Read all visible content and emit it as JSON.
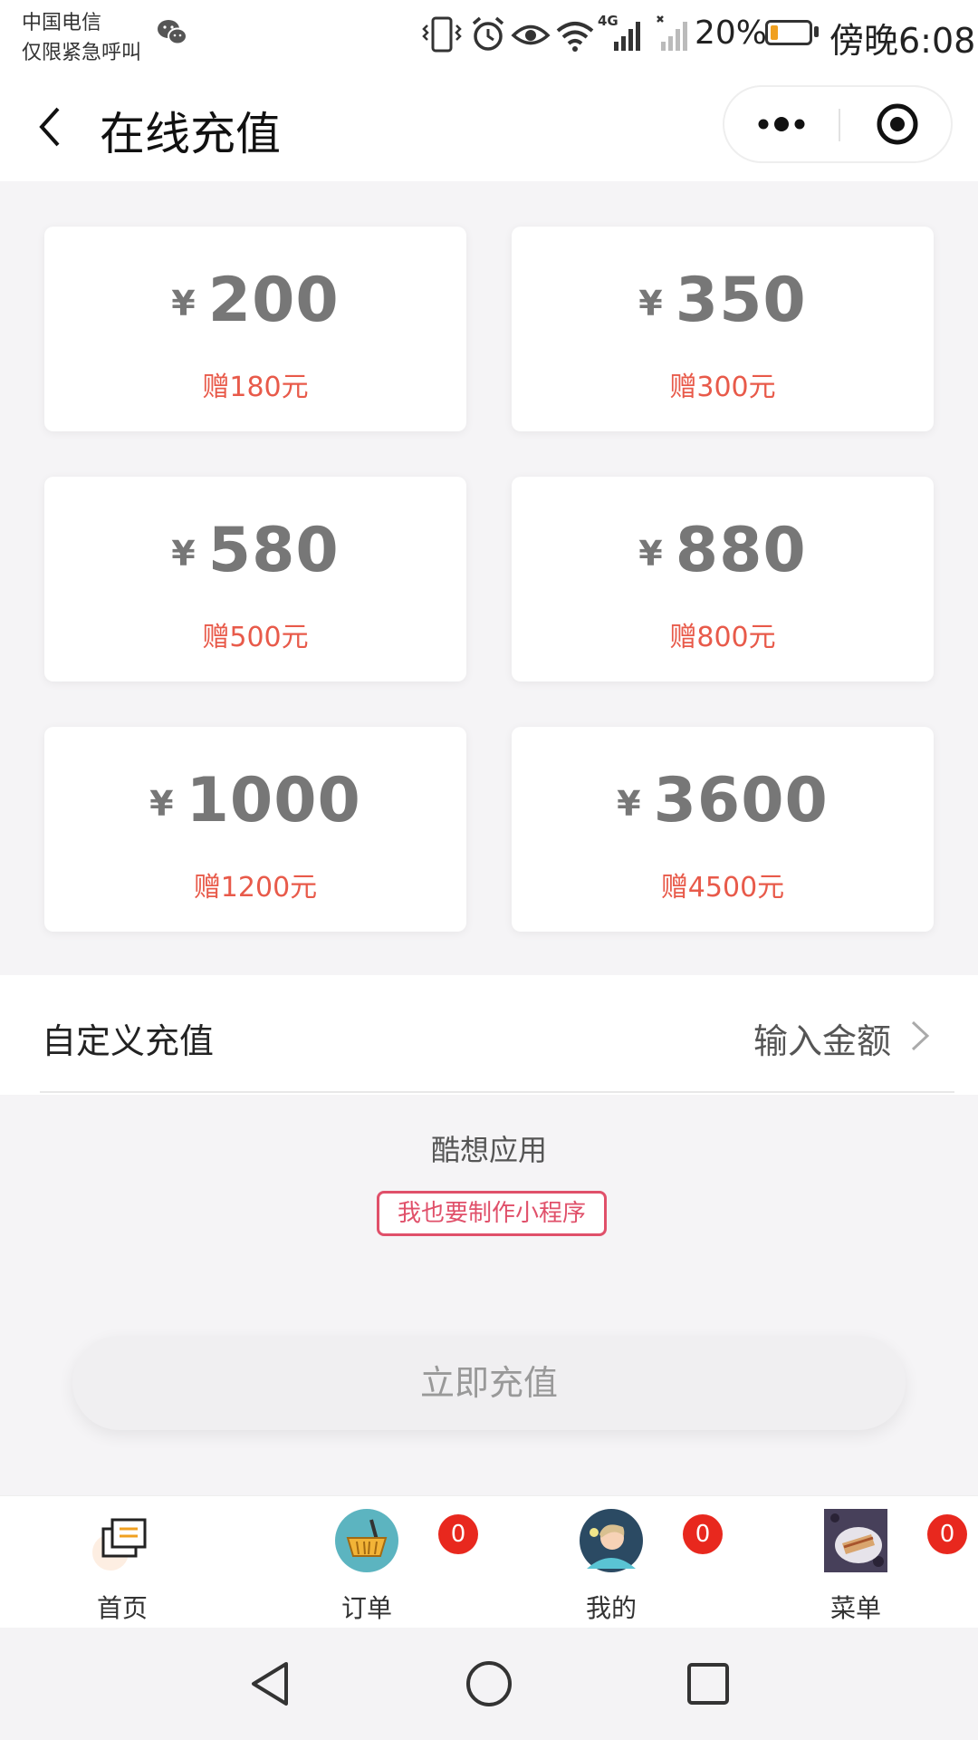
{
  "status_bar": {
    "carrier": "中国电信",
    "emergency": "仅限紧急呼叫",
    "network": "4G",
    "battery": "20%",
    "battery_level": 0.2,
    "time": "傍晚6:08",
    "icons": [
      "wechat-icon",
      "vibrate-icon",
      "alarm-icon",
      "eye-icon",
      "wifi-icon",
      "signal-icon",
      "no-signal-icon",
      "battery-icon"
    ]
  },
  "nav": {
    "title": "在线充值",
    "icons": [
      "back-arrow-icon",
      "more-dots-icon",
      "close-target-icon"
    ]
  },
  "colors": {
    "bonus": "#e85a4a",
    "accent": "#e0506a",
    "badge": "#e8281e",
    "amount": "#777777"
  },
  "packages": [
    {
      "currency": "¥",
      "amount": "200",
      "bonus": "赠180元"
    },
    {
      "currency": "¥",
      "amount": "350",
      "bonus": "赠300元"
    },
    {
      "currency": "¥",
      "amount": "580",
      "bonus": "赠500元"
    },
    {
      "currency": "¥",
      "amount": "880",
      "bonus": "赠800元"
    },
    {
      "currency": "¥",
      "amount": "1000",
      "bonus": "赠1200元"
    },
    {
      "currency": "¥",
      "amount": "3600",
      "bonus": "赠4500元"
    }
  ],
  "custom": {
    "label": "自定义充值",
    "input_label": "输入金额"
  },
  "footer": {
    "powered_by": "酷想应用",
    "make_button": "我也要制作小程序"
  },
  "recharge_button": "立即充值",
  "tabs": [
    {
      "label": "首页",
      "icon": "home-folder-icon",
      "badge": ""
    },
    {
      "label": "订单",
      "icon": "basket-icon",
      "badge": "0"
    },
    {
      "label": "我的",
      "icon": "avatar-icon",
      "badge": "0"
    },
    {
      "label": "菜单",
      "icon": "food-photo-icon",
      "badge": "0"
    }
  ],
  "system_nav": [
    "back-triangle-icon",
    "home-circle-icon",
    "recents-square-icon"
  ]
}
